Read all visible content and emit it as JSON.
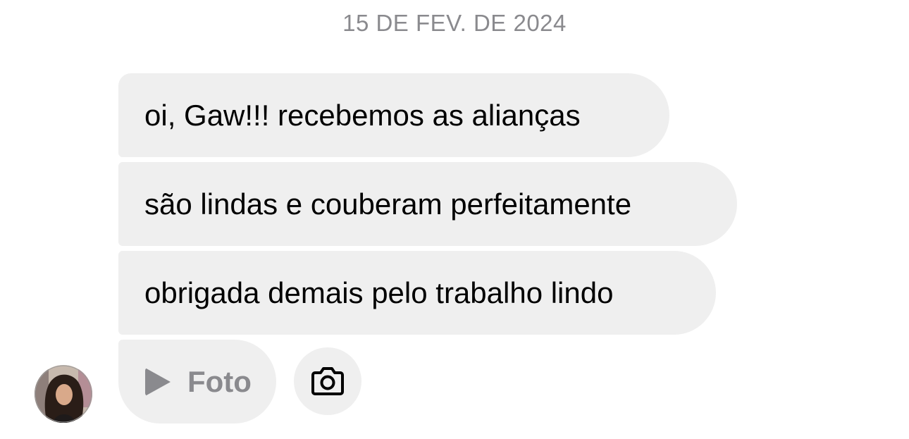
{
  "conversation": {
    "date_separator": "15 DE FEV. DE 2024",
    "messages": [
      {
        "text": "oi, Gaw!!! recebemos as alianças"
      },
      {
        "text": "são lindas e couberam perfeitamente"
      },
      {
        "text": "obrigada demais pelo trabalho lindo"
      }
    ],
    "media_message": {
      "icon": "play-icon",
      "label": "Foto"
    },
    "camera_action": {
      "icon": "camera-icon"
    },
    "sender": {
      "avatar_icon": "avatar"
    }
  },
  "colors": {
    "bubble": "#efefef",
    "text": "#000000",
    "muted_text": "#8a8a8e",
    "background": "#ffffff"
  }
}
